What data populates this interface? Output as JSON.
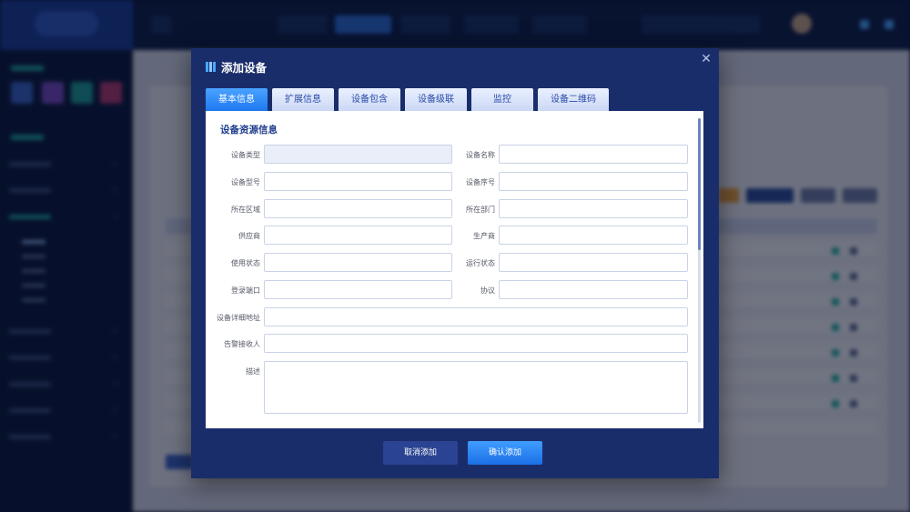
{
  "dialog": {
    "title": "添加设备",
    "close_icon": "close-icon"
  },
  "tabs": [
    {
      "label": "基本信息",
      "active": true
    },
    {
      "label": "扩展信息",
      "active": false
    },
    {
      "label": "设备包含",
      "active": false
    },
    {
      "label": "设备级联",
      "active": false
    },
    {
      "label": "监控",
      "active": false
    },
    {
      "label": "设备二维码",
      "active": false
    }
  ],
  "section": {
    "title": "设备资源信息"
  },
  "form": {
    "device_type": {
      "label": "设备类型",
      "value": ""
    },
    "device_name": {
      "label": "设备名称",
      "value": ""
    },
    "device_model": {
      "label": "设备型号",
      "value": ""
    },
    "device_serial": {
      "label": "设备序号",
      "value": ""
    },
    "region": {
      "label": "所在区域",
      "value": ""
    },
    "department": {
      "label": "所在部门",
      "value": ""
    },
    "supplier": {
      "label": "供应商",
      "value": ""
    },
    "manufacturer": {
      "label": "生产商",
      "value": ""
    },
    "usage_status": {
      "label": "使用状态",
      "value": ""
    },
    "run_status": {
      "label": "运行状态",
      "value": ""
    },
    "login_port": {
      "label": "登录端口",
      "value": ""
    },
    "protocol": {
      "label": "协议",
      "value": ""
    },
    "address": {
      "label": "设备详细地址",
      "value": ""
    },
    "alarm_receiver": {
      "label": "告警接收人",
      "value": ""
    },
    "description": {
      "label": "描述",
      "value": ""
    }
  },
  "footer": {
    "cancel_label": "取消添加",
    "confirm_label": "确认添加"
  },
  "colors": {
    "modal_bg": "#1a2d6b",
    "accent": "#1f78f0",
    "section_title": "#1e3c8c"
  }
}
